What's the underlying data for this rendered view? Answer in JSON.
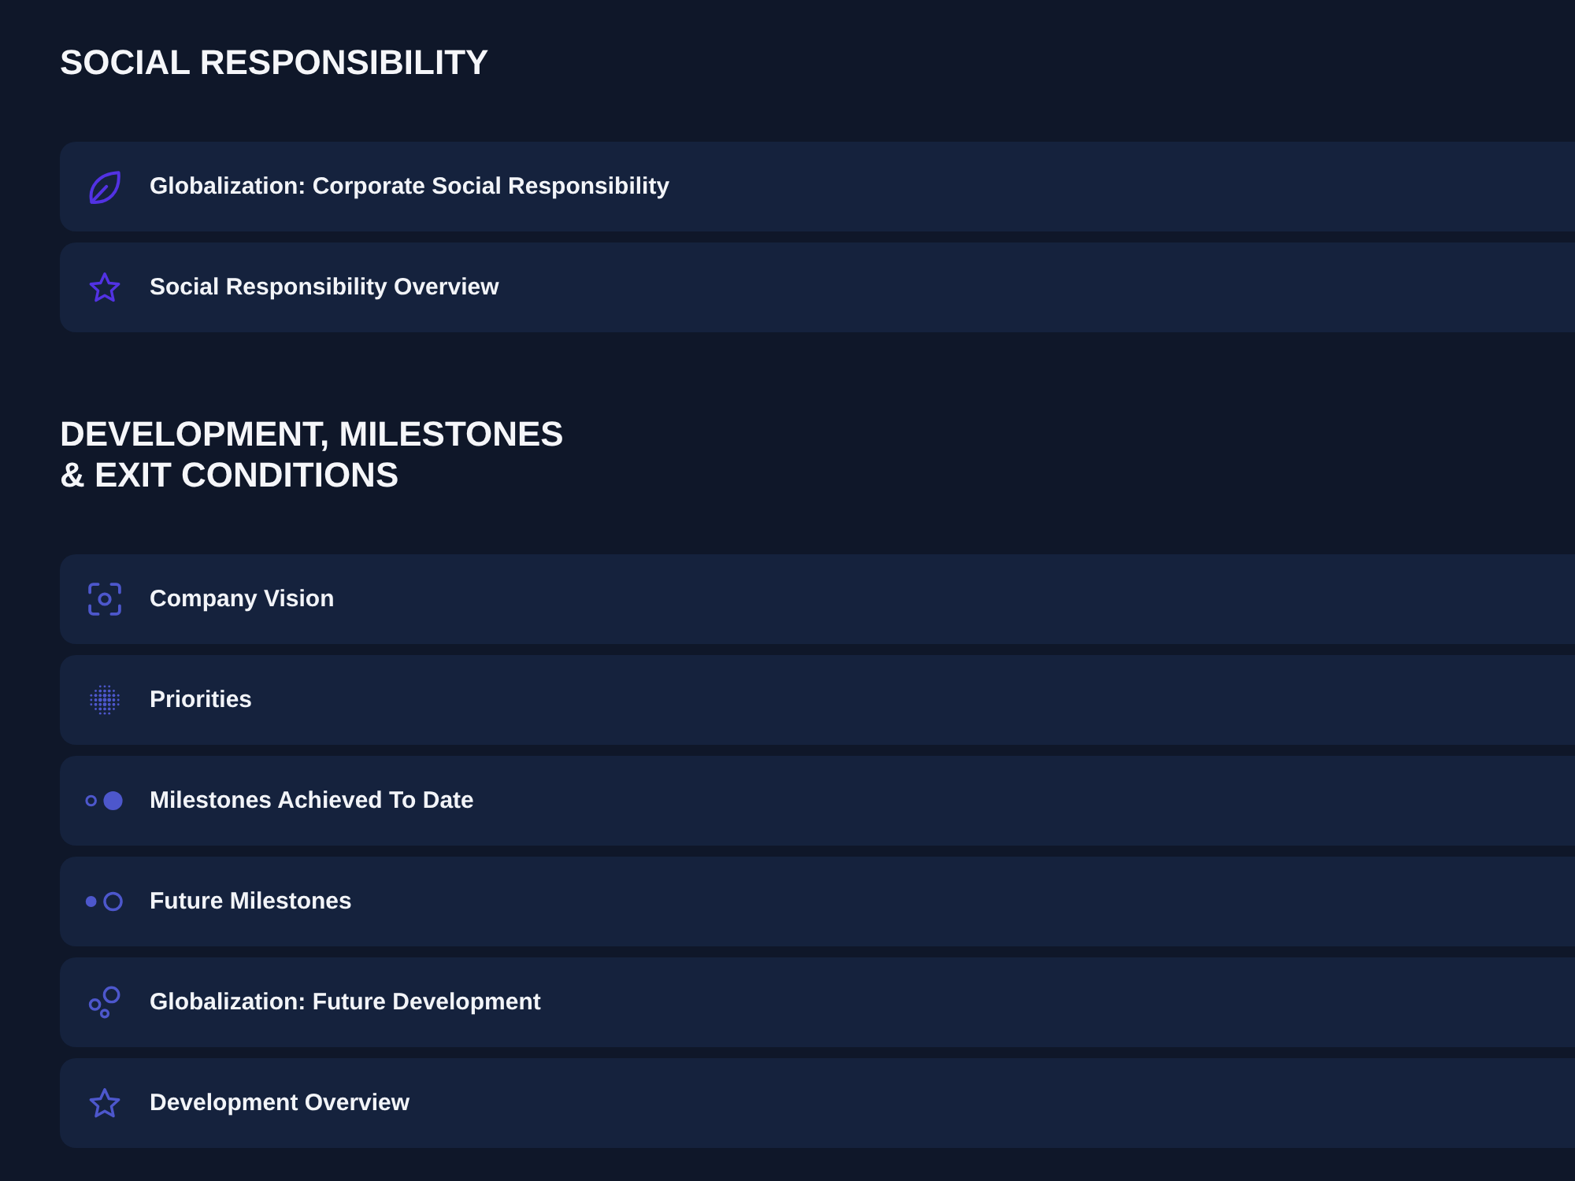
{
  "sections": [
    {
      "title": "SOCIAL RESPONSIBILITY",
      "color": "#5232e3",
      "items": [
        {
          "kind": "leaf",
          "label": "Globalization: Corporate Social Responsibility"
        },
        {
          "kind": "star",
          "label": "Social Responsibility Overview"
        }
      ]
    },
    {
      "title": "DEVELOPMENT, MILESTONES\n& EXIT CONDITIONS",
      "color": "#4d57cc",
      "items": [
        {
          "kind": "focus",
          "label": "Company Vision"
        },
        {
          "kind": "halftone",
          "label": "Priorities"
        },
        {
          "kind": "achieved",
          "label": "Milestones Achieved To Date"
        },
        {
          "kind": "future",
          "label": "Future Milestones"
        },
        {
          "kind": "bubbles",
          "label": "Globalization: Future Development"
        },
        {
          "kind": "star",
          "label": "Development Overview"
        }
      ]
    }
  ]
}
